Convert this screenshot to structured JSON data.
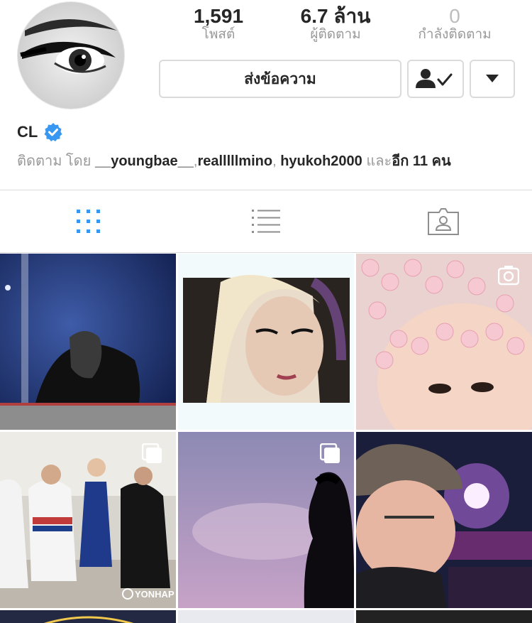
{
  "profile": {
    "username": "CL",
    "verified": true,
    "stats": {
      "posts": {
        "value": "1,591",
        "label": "โพสต์"
      },
      "followers": {
        "value": "6.7 ล้าน",
        "label": "ผู้ติดตาม"
      },
      "following": {
        "value": "0",
        "label": "กำลังติดตาม"
      }
    },
    "buttons": {
      "message": "ส่งข้อความ",
      "following_icon": "person-check-icon",
      "dropdown_icon": "triangle-down-icon"
    },
    "followed_by": {
      "prefix": "ติดตาม โดย",
      "users": [
        "__youngbae__",
        "realllllmino",
        "hyukoh2000"
      ],
      "sep1": ",",
      "sep2": ",",
      "and_text": "และ",
      "more": "อีก 11 คน"
    }
  },
  "tabs": [
    {
      "icon": "grid-icon",
      "active": true
    },
    {
      "icon": "list-icon",
      "active": false
    },
    {
      "icon": "tagged-icon",
      "active": false
    }
  ],
  "colors": {
    "accent": "#3897f0",
    "text": "#262626",
    "muted": "#999999",
    "border": "#dbdbdb"
  },
  "posts": [
    {
      "icon": "photo-stage-performer"
    },
    {
      "icon": "photo-selfie-blonde"
    },
    {
      "icon": "photo-baby-flower-crown",
      "badge": "video-icon"
    },
    {
      "icon": "photo-group-olympics",
      "badge": "multiple-icon",
      "watermark": "YONHAP"
    },
    {
      "icon": "photo-silhouette-sky",
      "badge": "multiple-icon"
    },
    {
      "icon": "photo-man-cap-stadium"
    }
  ]
}
